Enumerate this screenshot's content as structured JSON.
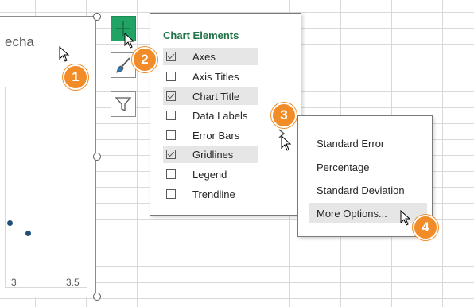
{
  "chart": {
    "title_partial": "echa",
    "x_ticks": [
      "3",
      "3.5"
    ]
  },
  "sidebar_buttons": [
    {
      "name": "chart-elements",
      "icon": "plus-icon",
      "active": true
    },
    {
      "name": "chart-styles",
      "icon": "paintbrush-icon",
      "active": false
    },
    {
      "name": "chart-filters",
      "icon": "funnel-icon",
      "active": false
    }
  ],
  "chart_elements_panel": {
    "title": "Chart Elements",
    "items": [
      {
        "label": "Axes",
        "checked": true
      },
      {
        "label": "Axis Titles",
        "checked": false
      },
      {
        "label": "Chart Title",
        "checked": true
      },
      {
        "label": "Data Labels",
        "checked": false
      },
      {
        "label": "Error Bars",
        "checked": false
      },
      {
        "label": "Gridlines",
        "checked": true
      },
      {
        "label": "Legend",
        "checked": false
      },
      {
        "label": "Trendline",
        "checked": false
      }
    ]
  },
  "error_bars_submenu": {
    "items": [
      {
        "label": "Standard Error"
      },
      {
        "label": "Percentage"
      },
      {
        "label": "Standard Deviation"
      },
      {
        "label": "More Options..."
      }
    ]
  },
  "step_badges": [
    "1",
    "2",
    "3",
    "4"
  ],
  "colors": {
    "accent_green": "#21a366",
    "badge_orange": "#f28c28",
    "panel_title_green": "#217346",
    "data_point": "#1f4e79"
  }
}
